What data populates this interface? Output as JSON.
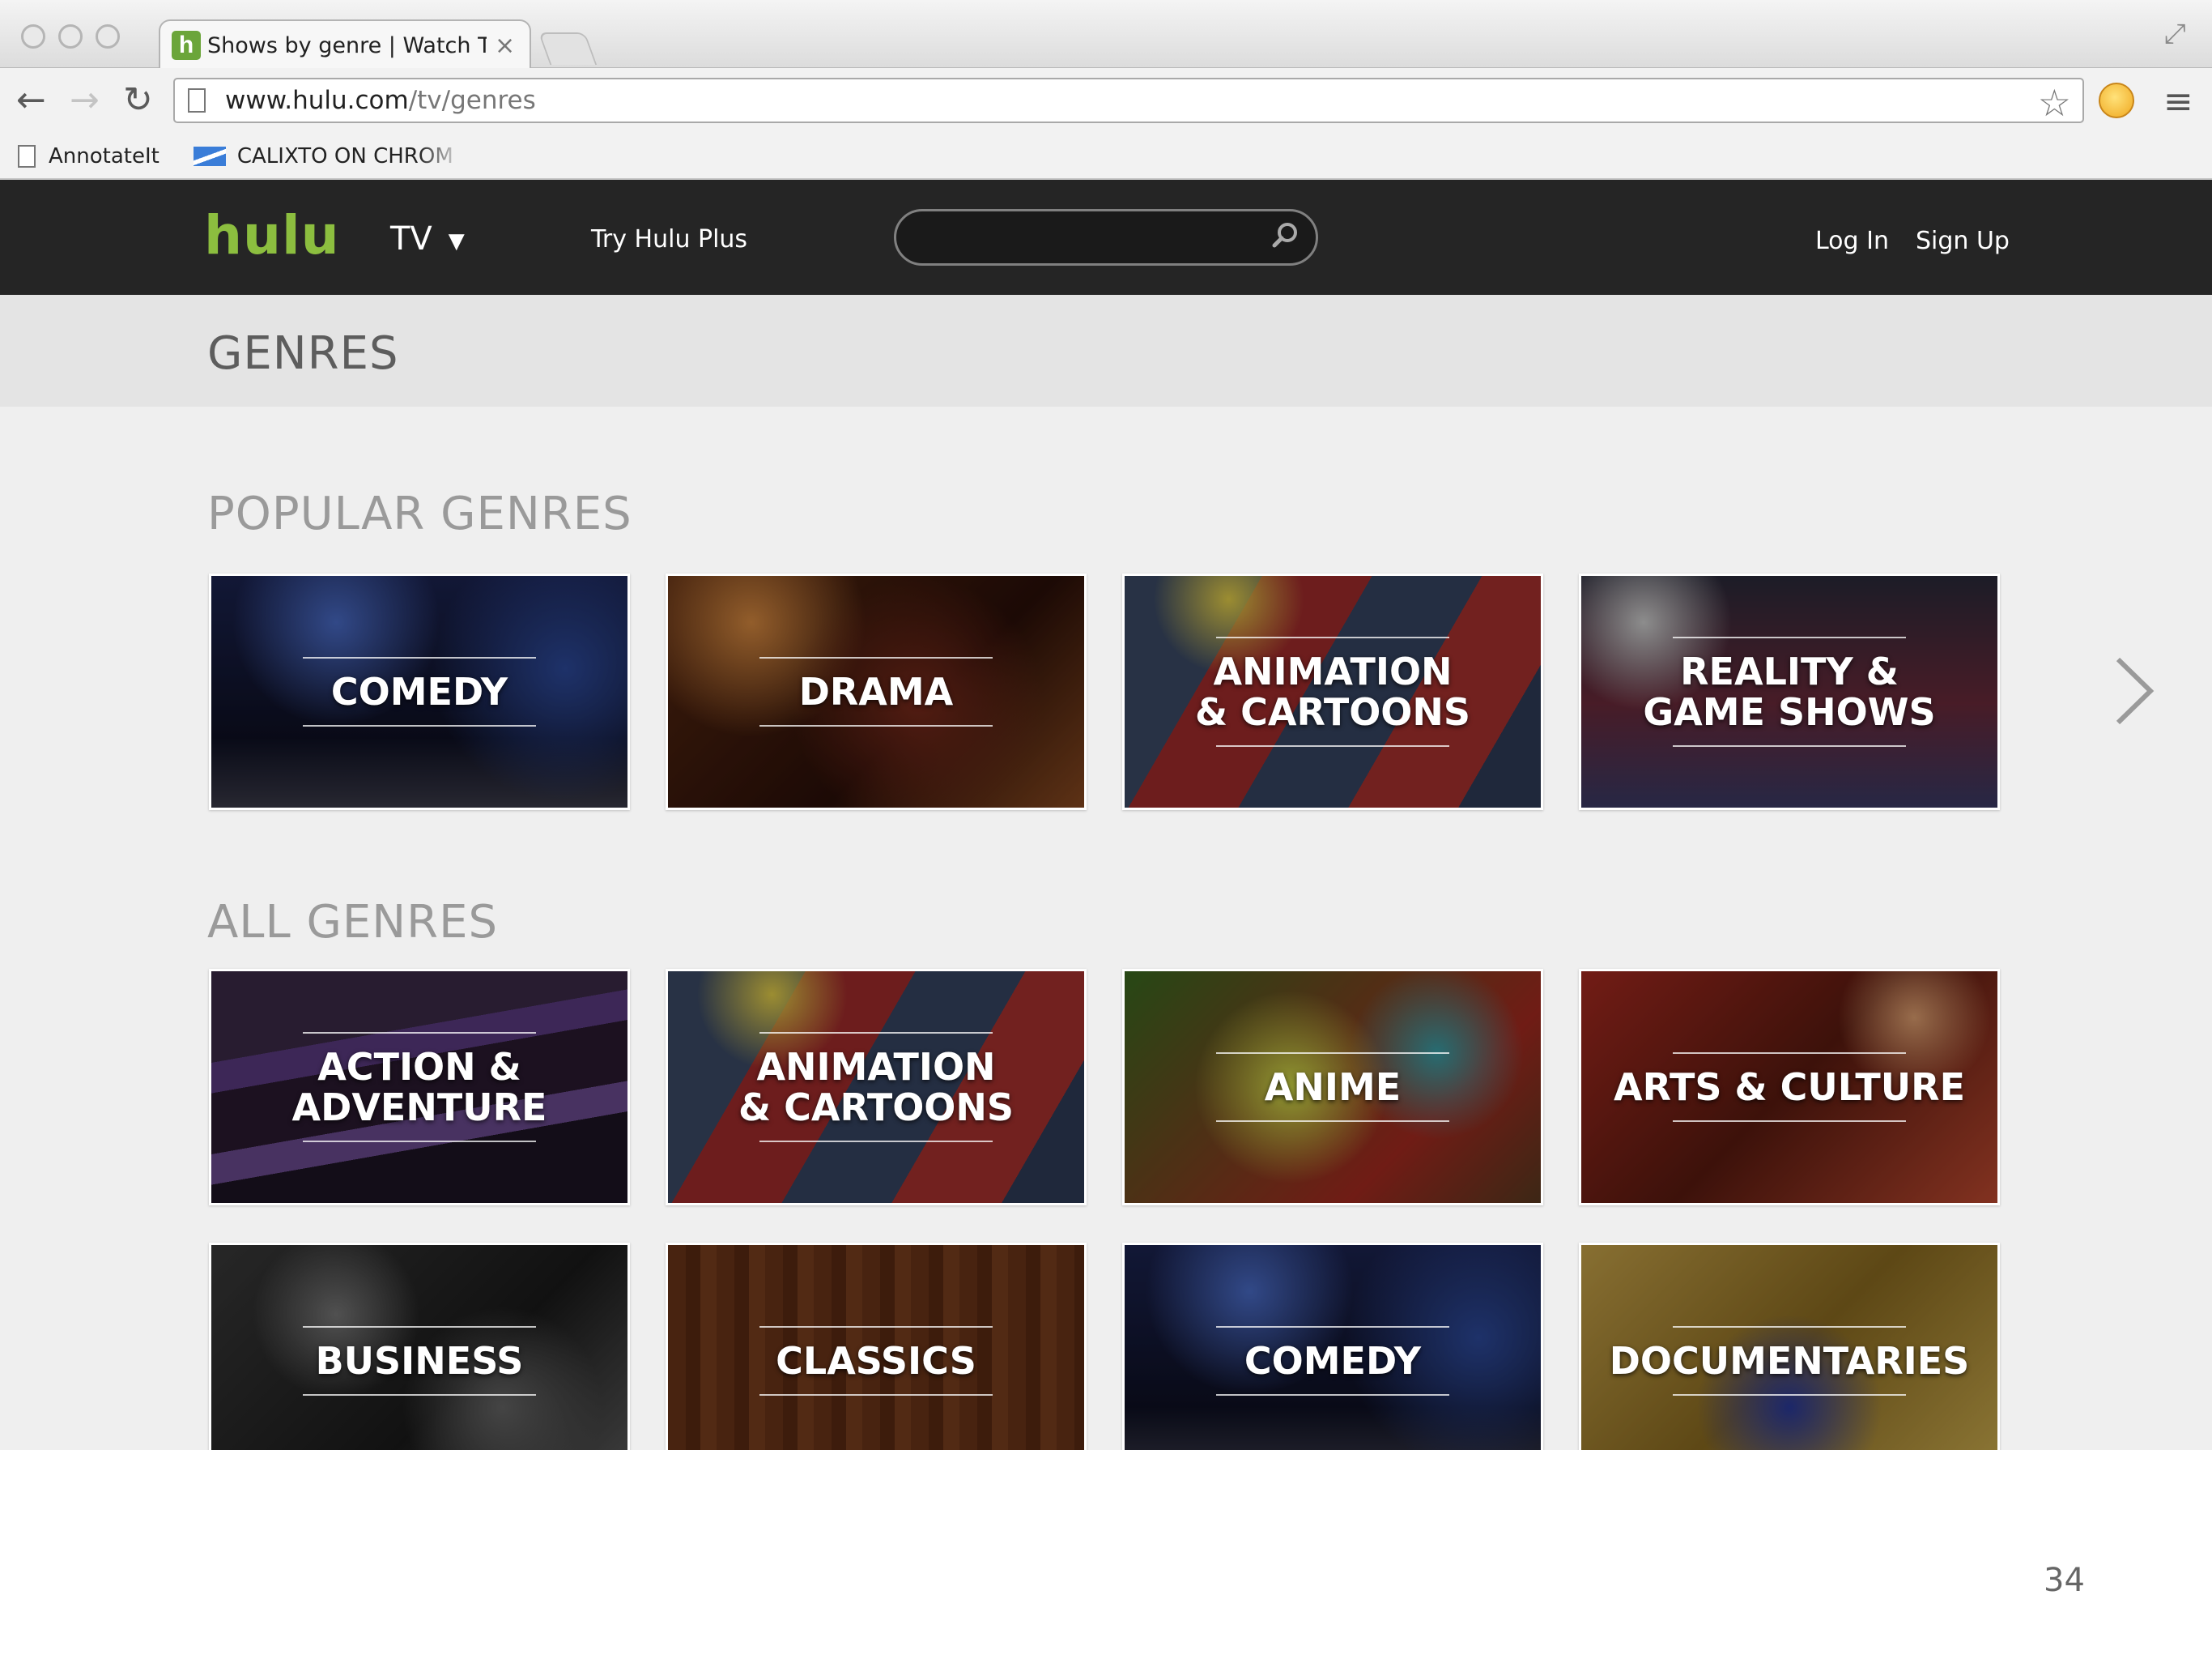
{
  "browser": {
    "tab_title": "Shows by genre | Watch TV o",
    "tab_favicon": "h",
    "tab_close": "×",
    "url_domain": "www.hulu.com",
    "url_path": "/tv/genres",
    "bookmarks": [
      {
        "label": "AnnotateIt",
        "icon": "page-icon"
      },
      {
        "label": "CALIXTO ON CHROM",
        "icon": "flag-icon"
      }
    ]
  },
  "site": {
    "logo": "hulu",
    "logo_color": "#8cbe3f",
    "tv_menu": "TV",
    "try_plus": "Try Hulu Plus",
    "search_placeholder": "",
    "login": "Log In",
    "signup": "Sign Up"
  },
  "page": {
    "title": "GENRES",
    "popular_title": "POPULAR GENRES",
    "all_title": "ALL GENRES",
    "popular": [
      {
        "label": "COMEDY"
      },
      {
        "label": "DRAMA"
      },
      {
        "label": "ANIMATION\n& CARTOONS"
      },
      {
        "label": "REALITY &\nGAME SHOWS"
      }
    ],
    "all": [
      {
        "label": "ACTION &\nADVENTURE"
      },
      {
        "label": "ANIMATION\n& CARTOONS"
      },
      {
        "label": "ANIME"
      },
      {
        "label": "ARTS & CULTURE"
      },
      {
        "label": "BUSINESS"
      },
      {
        "label": "CLASSICS"
      },
      {
        "label": "COMEDY"
      },
      {
        "label": "DOCUMENTARIES"
      }
    ]
  },
  "slide_number": "34"
}
